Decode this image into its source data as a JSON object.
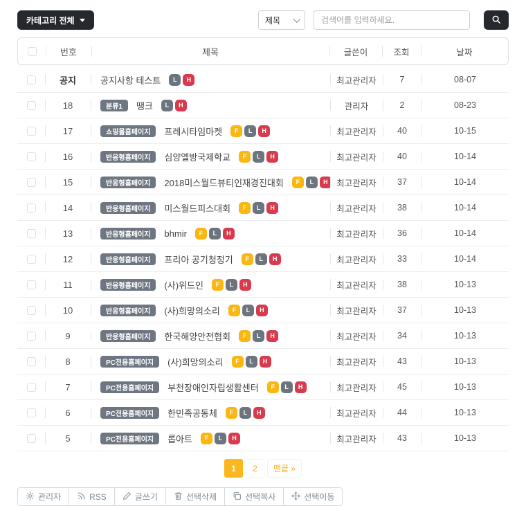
{
  "filters": {
    "category_button": "카테고리 전체",
    "search_field_select": "제목",
    "search_placeholder": "검색어를 입력하세요."
  },
  "table": {
    "headers": {
      "number": "번호",
      "title": "제목",
      "author": "글쓴이",
      "views": "조회",
      "date": "날짜"
    },
    "rows": [
      {
        "number": "공지",
        "notice": true,
        "category": "",
        "title": "공지사항 테스트",
        "badges": [
          "L",
          "H"
        ],
        "author": "최고관리자",
        "views": "7",
        "date": "08-07"
      },
      {
        "number": "18",
        "notice": false,
        "category": "분류1",
        "title": "땡크",
        "badges": [
          "L",
          "H"
        ],
        "author": "관리자",
        "views": "2",
        "date": "08-23"
      },
      {
        "number": "17",
        "notice": false,
        "category": "쇼핑몰홈페이지",
        "title": "프레시타임마켓",
        "badges": [
          "F",
          "L",
          "H"
        ],
        "author": "최고관리자",
        "views": "40",
        "date": "10-15"
      },
      {
        "number": "16",
        "notice": false,
        "category": "반응형홈페이지",
        "title": "심양엘방국제학교",
        "badges": [
          "F",
          "L",
          "H"
        ],
        "author": "최고관리자",
        "views": "40",
        "date": "10-14"
      },
      {
        "number": "15",
        "notice": false,
        "category": "반응형홈페이지",
        "title": "2018미스월드뷰티인재경진대회",
        "badges": [
          "F",
          "L",
          "H"
        ],
        "author": "최고관리자",
        "views": "37",
        "date": "10-14"
      },
      {
        "number": "14",
        "notice": false,
        "category": "반응형홈페이지",
        "title": "미스월드피스대회",
        "badges": [
          "F",
          "L",
          "H"
        ],
        "author": "최고관리자",
        "views": "38",
        "date": "10-14"
      },
      {
        "number": "13",
        "notice": false,
        "category": "반응형홈페이지",
        "title": "bhmir",
        "badges": [
          "F",
          "L",
          "H"
        ],
        "author": "최고관리자",
        "views": "36",
        "date": "10-14"
      },
      {
        "number": "12",
        "notice": false,
        "category": "반응형홈페이지",
        "title": "프리아 공기청정기",
        "badges": [
          "F",
          "L",
          "H"
        ],
        "author": "최고관리자",
        "views": "33",
        "date": "10-14"
      },
      {
        "number": "11",
        "notice": false,
        "category": "반응형홈페이지",
        "title": "(사)위드인",
        "badges": [
          "F",
          "L",
          "H"
        ],
        "author": "최고관리자",
        "views": "38",
        "date": "10-13"
      },
      {
        "number": "10",
        "notice": false,
        "category": "반응형홈페이지",
        "title": "(사)희망의소리",
        "badges": [
          "F",
          "L",
          "H"
        ],
        "author": "최고관리자",
        "views": "37",
        "date": "10-13"
      },
      {
        "number": "9",
        "notice": false,
        "category": "반응형홈페이지",
        "title": "한국해양안전협회",
        "badges": [
          "F",
          "L",
          "H"
        ],
        "author": "최고관리자",
        "views": "34",
        "date": "10-13"
      },
      {
        "number": "8",
        "notice": false,
        "category": "PC전용홈페이지",
        "title": "(사)희망의소리",
        "badges": [
          "F",
          "L",
          "H"
        ],
        "author": "최고관리자",
        "views": "43",
        "date": "10-13"
      },
      {
        "number": "7",
        "notice": false,
        "category": "PC전용홈페이지",
        "title": "부천장애인자립생활센터",
        "badges": [
          "F",
          "L",
          "H"
        ],
        "author": "최고관리자",
        "views": "45",
        "date": "10-13"
      },
      {
        "number": "6",
        "notice": false,
        "category": "PC전용홈페이지",
        "title": "한민족공동체",
        "badges": [
          "F",
          "L",
          "H"
        ],
        "author": "최고관리자",
        "views": "44",
        "date": "10-13"
      },
      {
        "number": "5",
        "notice": false,
        "category": "PC전용홈페이지",
        "title": "롭아트",
        "badges": [
          "F",
          "L",
          "H"
        ],
        "author": "최고관리자",
        "views": "43",
        "date": "10-13"
      }
    ]
  },
  "pagination": {
    "pages": [
      {
        "label": "1",
        "active": true
      },
      {
        "label": "2",
        "active": false
      },
      {
        "label": "맨끝 »",
        "active": false
      }
    ]
  },
  "toolbar": {
    "buttons": [
      {
        "icon": "gear-icon",
        "label": "관리자"
      },
      {
        "icon": "rss-icon",
        "label": "RSS"
      },
      {
        "icon": "pencil-icon",
        "label": "글쓰기"
      },
      {
        "icon": "trash-icon",
        "label": "선택삭제"
      },
      {
        "icon": "copy-icon",
        "label": "선택복사"
      },
      {
        "icon": "move-icon",
        "label": "선택이동"
      }
    ]
  },
  "colors": {
    "dark_button": "#25282c",
    "accent_yellow": "#fbb81e",
    "flag_f": "#fbb60f",
    "flag_l": "#6c757d",
    "flag_h": "#d93a4d",
    "category_badge": "#6d7681"
  }
}
